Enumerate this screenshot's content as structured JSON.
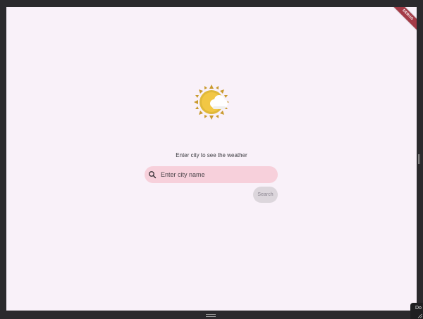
{
  "app": {
    "debug_banner": "DEBUG",
    "prompt": "Enter city to see the weather",
    "weather_icon": "sun-behind-cloud-icon"
  },
  "search": {
    "placeholder": "Enter city name",
    "value": "",
    "icon": "search-icon",
    "button_label": "Search"
  },
  "window": {
    "corner_tooltip": "Do"
  },
  "colors": {
    "surface": "#f9f1f9",
    "field_fill": "#f7d0db",
    "button_fill": "#dcd6dc",
    "ribbon": "#a43b47",
    "sun": "#f2c744"
  }
}
